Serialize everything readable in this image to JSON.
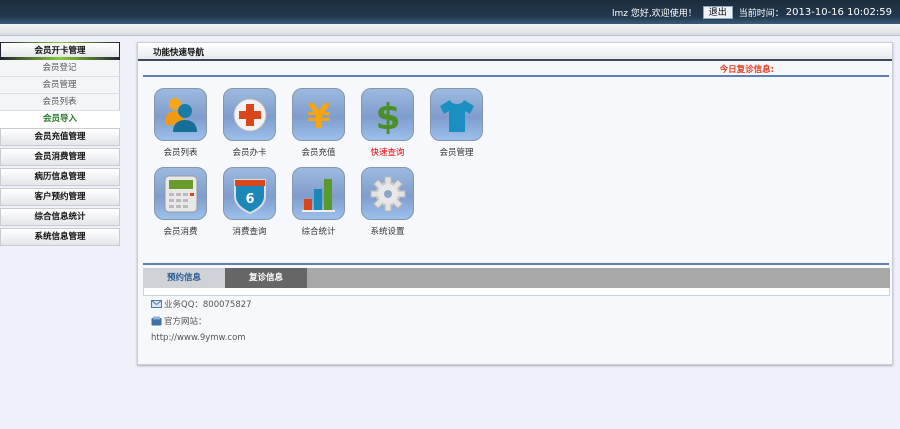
{
  "header": {
    "greeting": "lmz 您好,欢迎使用！",
    "logout": "退出",
    "time_label": "当前时间：",
    "time": "2013-10-16 10:02:59"
  },
  "sidebar": {
    "groups": [
      {
        "label": "会员开卡管理",
        "items": [
          "会员登记",
          "会员管理",
          "会员列表",
          "会员导入"
        ],
        "active_item": "会员导入"
      },
      {
        "label": "会员充值管理"
      },
      {
        "label": "会员消费管理"
      },
      {
        "label": "病历信息管理"
      },
      {
        "label": "客户预约管理"
      },
      {
        "label": "综合信息统计"
      },
      {
        "label": "系统信息管理"
      }
    ]
  },
  "main": {
    "title": "功能快速导航",
    "notice": "今日复诊信息:",
    "icons": [
      {
        "label": "会员列表",
        "icon": "members-icon"
      },
      {
        "label": "会员办卡",
        "icon": "add-card-icon"
      },
      {
        "label": "会员充值",
        "icon": "yen-icon"
      },
      {
        "label": "快速查询",
        "icon": "dollar-icon",
        "highlight": "#e00000"
      },
      {
        "label": "会员管理",
        "icon": "tshirt-icon"
      },
      {
        "label": "会员消费",
        "icon": "calculator-icon"
      },
      {
        "label": "消费查询",
        "icon": "badge-icon"
      },
      {
        "label": "综合统计",
        "icon": "bar-chart-icon"
      },
      {
        "label": "系统设置",
        "icon": "gear-icon"
      }
    ],
    "tabs": [
      "预约信息",
      "复诊信息"
    ],
    "contact": {
      "qq": "业务QQ：800075827",
      "site_label": "官方网站：",
      "url": "http://www.9ymw.com"
    }
  }
}
